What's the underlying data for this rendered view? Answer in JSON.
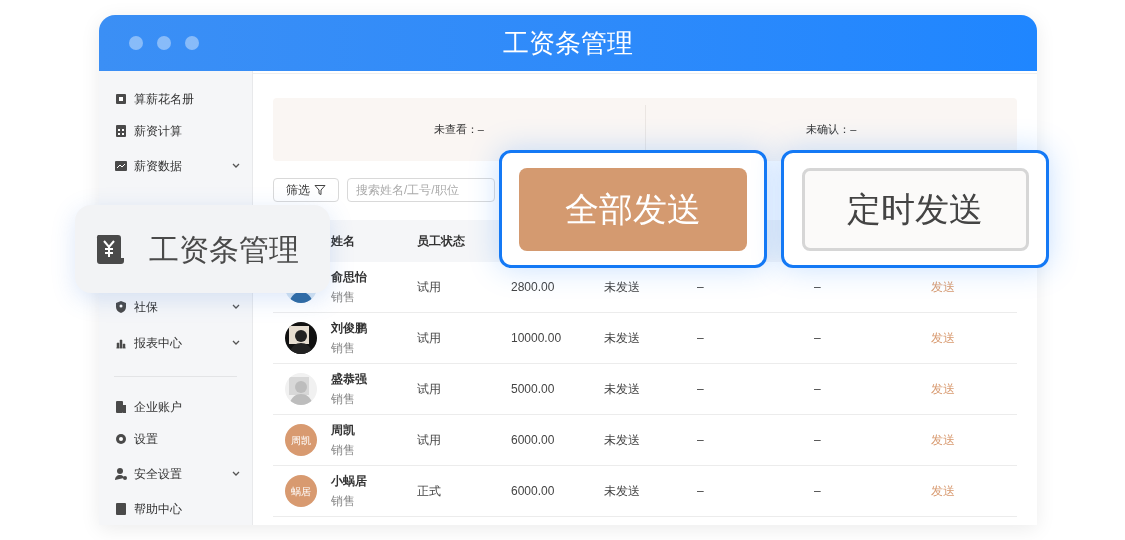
{
  "window": {
    "title": "工资条管理"
  },
  "sidebar": {
    "items": [
      {
        "label": "算薪花名册",
        "has_submenu": false
      },
      {
        "label": "薪资计算",
        "has_submenu": false
      },
      {
        "label": "薪资数据",
        "has_submenu": true
      },
      {
        "label": "社保",
        "has_submenu": true
      },
      {
        "label": "报表中心",
        "has_submenu": true
      }
    ],
    "bottom_items": [
      {
        "label": "企业账户",
        "has_submenu": false
      },
      {
        "label": "设置",
        "has_submenu": false
      },
      {
        "label": "安全设置",
        "has_submenu": true
      },
      {
        "label": "帮助中心",
        "has_submenu": false
      }
    ]
  },
  "summary": [
    {
      "label": "未查看：–"
    },
    {
      "label": "未确认：–"
    }
  ],
  "filter_button": "筛选",
  "search": {
    "placeholder": "搜索姓名/工号/职位"
  },
  "table": {
    "columns": [
      "姓名",
      "员工状态"
    ],
    "rows": [
      {
        "name": "俞思怡",
        "dept": "销售",
        "status": "试用",
        "salary": "2800.00",
        "send_status": "未发送",
        "column_6": "–",
        "column_7": "–",
        "action": "发送"
      },
      {
        "name": "刘俊鹏",
        "dept": "销售",
        "status": "试用",
        "salary": "10000.00",
        "send_status": "未发送",
        "column_6": "–",
        "column_7": "–",
        "action": "发送"
      },
      {
        "name": "盛恭强",
        "dept": "销售",
        "status": "试用",
        "salary": "5000.00",
        "send_status": "未发送",
        "column_6": "–",
        "column_7": "–",
        "action": "发送"
      },
      {
        "avatar": {
          "kind": "initials",
          "text": "周凯"
        },
        "name": "周凯",
        "dept": "销售",
        "status": "试用",
        "salary": "6000.00",
        "send_status": "未发送",
        "column_6": "–",
        "column_7": "–",
        "action": "发送"
      },
      {
        "avatar": {
          "kind": "initials",
          "text": "蜗居"
        },
        "name": "小蜗居",
        "dept": "销售",
        "status": "正式",
        "salary": "6000.00",
        "send_status": "未发送",
        "column_6": "–",
        "column_7": "–",
        "action": "发送"
      }
    ]
  },
  "callout": {
    "label": "工资条管理"
  },
  "highlight_buttons": [
    {
      "label": "全部发送",
      "kind": "primary"
    },
    {
      "label": "定时发送",
      "kind": "secondary"
    }
  ]
}
